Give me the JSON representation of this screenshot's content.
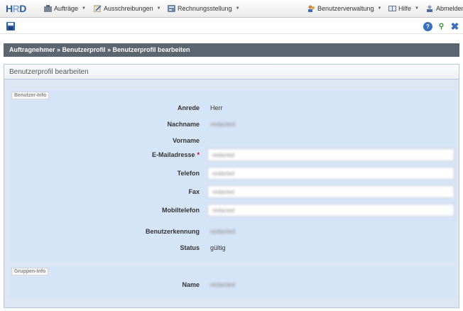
{
  "nav": {
    "logo": {
      "h": "H",
      "r": "R",
      "d": "D"
    },
    "items": [
      {
        "label": "Aufträge",
        "icon": "orders-icon"
      },
      {
        "label": "Ausschreibungen",
        "icon": "tenders-icon"
      },
      {
        "label": "Rechnungsstellung",
        "icon": "invoice-icon"
      },
      {
        "label": "Benutzerverwaltung",
        "icon": "users-icon"
      },
      {
        "label": "Hilfe",
        "icon": "help-book-icon"
      },
      {
        "label": "Abmelden",
        "icon": "logout-icon"
      }
    ]
  },
  "toolbar": {
    "save_icon": "save-icon",
    "help_icon": "help-icon",
    "search_icon": "search-icon",
    "close_icon": "close-icon",
    "help_glyph": "?",
    "search_glyph": "⚲",
    "close_glyph": "✖"
  },
  "breadcrumb": "Auftragnehmer » Benutzerprofil » Benutzerprofil bearbeiten",
  "panel": {
    "title": "Benutzerprofil bearbeiten",
    "benutzer_info": {
      "legend": "Benutzer-Info",
      "anrede": {
        "label": "Anrede",
        "value": "Herr"
      },
      "nachname": {
        "label": "Nachname",
        "value": "redacted"
      },
      "vorname": {
        "label": "Vorname",
        "value": ""
      },
      "email": {
        "label": "E-Mailadresse",
        "required": "*",
        "value": "redacted"
      },
      "telefon": {
        "label": "Telefon",
        "value": "redacted"
      },
      "fax": {
        "label": "Fax",
        "value": "redacted"
      },
      "mobil": {
        "label": "Mobiltelefon",
        "value": "redacted"
      },
      "kennung": {
        "label": "Benutzerkennung",
        "value": "redacted"
      },
      "status": {
        "label": "Status",
        "value": "gültig"
      }
    },
    "gruppen_info": {
      "legend": "Gruppen-Info",
      "name": {
        "label": "Name",
        "value": "redacted"
      }
    }
  },
  "colors": {
    "breadcrumb_bg": "#5b6670",
    "panel_bg": "#dde7f3",
    "accent": "#2e5c9a"
  }
}
